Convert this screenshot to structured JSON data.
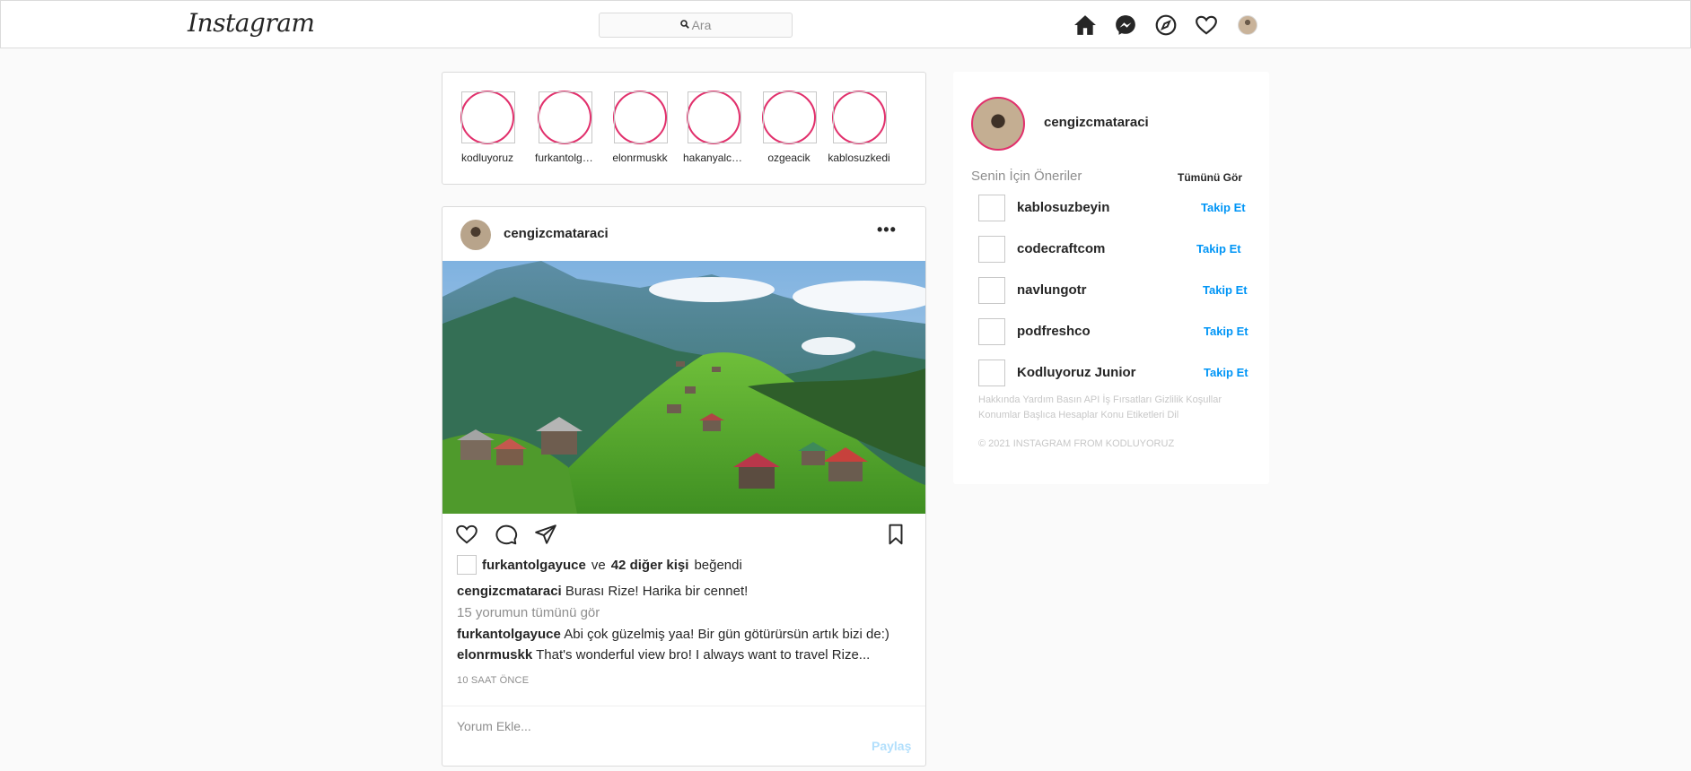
{
  "header": {
    "logo": "Instagram",
    "search_placeholder": "Ara",
    "nav_icons": [
      "home-icon",
      "messenger-icon",
      "explore-icon",
      "heart-icon",
      "profile-avatar"
    ]
  },
  "stories": [
    {
      "name": "kodluyoruz"
    },
    {
      "name": "furkantolgayuce"
    },
    {
      "name": "elonrmuskk"
    },
    {
      "name": "hakanyalcinkaya"
    },
    {
      "name": "ozgeacik"
    },
    {
      "name": "kablosuzkedi"
    }
  ],
  "post": {
    "username": "cengizcmataraci",
    "more_label": "•••",
    "likes": {
      "user": "furkantolgayuce",
      "connector": "ve",
      "others": "42 diğer kişi",
      "suffix": "beğendi"
    },
    "caption": {
      "user": "cengizcmataraci",
      "text": "Burası Rize! Harika bir cennet!"
    },
    "view_all": "15 yorumun tümünü gör",
    "comments": [
      {
        "user": "furkantolgayuce",
        "text": "Abi çok güzelmiş yaa! Bir gün götürürsün artık bizi de:)"
      },
      {
        "user": "elonrmuskk",
        "text": "That's wonderful view bro! I always want to travel Rize..."
      }
    ],
    "time": "10 SAAT ÖNCE",
    "add_comment_placeholder": "Yorum Ekle...",
    "share_label": "Paylaş"
  },
  "sidebar": {
    "username": "cengizcmataraci",
    "suggestions_title": "Senin İçin Öneriler",
    "see_all": "Tümünü Gör",
    "suggestions": [
      {
        "name": "kablosuzbeyin",
        "action": "Takip Et"
      },
      {
        "name": "codecraftcom",
        "action": "Takip Et"
      },
      {
        "name": "navlungotr",
        "action": "Takip Et"
      },
      {
        "name": "podfreshco",
        "action": "Takip Et"
      },
      {
        "name": "Kodluyoruz Junior",
        "action": "Takip Et"
      }
    ],
    "footer_links": "Hakkında Yardım Basın API İş Fırsatları Gizlilik Koşullar Konumlar Başlıca Hesaplar Konu Etiketleri Dil",
    "copyright": "© 2021 INSTAGRAM FROM KODLUYORUZ"
  },
  "colors": {
    "accent": "#0095f6",
    "story_ring": "#e1306c",
    "muted": "#8e8e8e",
    "border": "#dbdbdb"
  }
}
